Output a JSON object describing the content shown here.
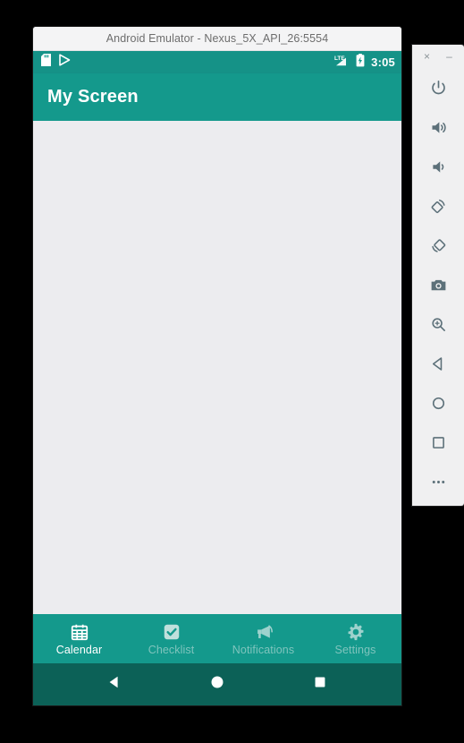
{
  "window": {
    "title": "Android Emulator - Nexus_5X_API_26:5554"
  },
  "colors": {
    "app_bar": "#14998c",
    "status_bar": "#159287",
    "system_nav_bar": "#0c6157",
    "content_background": "#ececef",
    "active_tab": "#ffffff",
    "inactive_tab": "#7fc4bd",
    "toolbar_background": "#f0f0f1",
    "toolbar_icon": "#5c7079"
  },
  "status_bar": {
    "notification_icons": [
      {
        "name": "sd-card-icon"
      },
      {
        "name": "play-store-icon"
      }
    ],
    "signal_label": "LTE",
    "icons": [
      {
        "name": "lte-signal-icon"
      },
      {
        "name": "battery-charging-icon"
      }
    ],
    "clock": "3:05"
  },
  "app_bar": {
    "title": "My Screen"
  },
  "content": {
    "body_text": ""
  },
  "bottom_nav": {
    "tabs": [
      {
        "label": "Calendar",
        "icon": "calendar-icon",
        "active": true
      },
      {
        "label": "Checklist",
        "icon": "checklist-icon",
        "active": false
      },
      {
        "label": "Notifications",
        "icon": "megaphone-icon",
        "active": false
      },
      {
        "label": "Settings",
        "icon": "gear-icon",
        "active": false
      }
    ]
  },
  "system_nav": {
    "buttons": [
      {
        "name": "back-button",
        "icon": "back-triangle-icon"
      },
      {
        "name": "home-button",
        "icon": "home-circle-icon"
      },
      {
        "name": "recents-button",
        "icon": "recents-square-icon"
      }
    ]
  },
  "emulator_toolbar": {
    "window_controls": [
      {
        "name": "close-button",
        "glyph": "×"
      },
      {
        "name": "minimize-button",
        "glyph": "–"
      }
    ],
    "buttons": [
      {
        "name": "power-button",
        "icon": "power-icon"
      },
      {
        "name": "volume-up-button",
        "icon": "volume-up-icon"
      },
      {
        "name": "volume-down-button",
        "icon": "volume-down-icon"
      },
      {
        "name": "rotate-left-button",
        "icon": "rotate-left-icon"
      },
      {
        "name": "rotate-right-button",
        "icon": "rotate-right-icon"
      },
      {
        "name": "screenshot-button",
        "icon": "camera-icon"
      },
      {
        "name": "zoom-button",
        "icon": "zoom-in-icon"
      },
      {
        "name": "back-button",
        "icon": "back-triangle-outline-icon"
      },
      {
        "name": "home-button",
        "icon": "home-circle-outline-icon"
      },
      {
        "name": "overview-button",
        "icon": "recents-square-outline-icon"
      },
      {
        "name": "more-button",
        "icon": "more-dots-icon"
      }
    ]
  }
}
